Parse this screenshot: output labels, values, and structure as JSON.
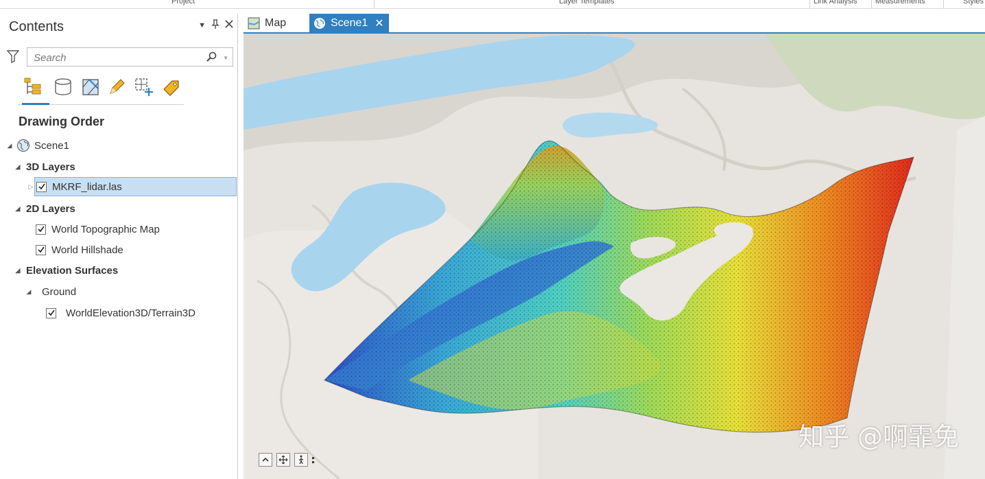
{
  "ribbon": {
    "groups": [
      "Project",
      "Layer Templates",
      "Link Analysis",
      "Measurements",
      "Styles"
    ]
  },
  "contents_pane": {
    "title": "Contents",
    "controls": [
      "chevron-down-icon",
      "pin-icon",
      "close-icon"
    ],
    "search": {
      "placeholder": "Search",
      "value": ""
    },
    "toolbar_icons": [
      "list-by-drawing-order-icon",
      "list-by-data-source-icon",
      "list-by-selection-icon",
      "list-by-editing-icon",
      "list-by-snapping-icon",
      "list-by-labeling-icon"
    ],
    "heading": "Drawing Order",
    "tree": {
      "scene": "Scene1",
      "group_3d": "3D Layers",
      "layer_lidar": "MKRF_lidar.las",
      "group_2d": "2D Layers",
      "layer_topo": "World Topographic Map",
      "layer_hillshade": "World Hillshade",
      "group_elev": "Elevation Surfaces",
      "ground": "Ground",
      "layer_terrain": "WorldElevation3D/Terrain3D"
    }
  },
  "tabs": [
    {
      "label": "Map",
      "icon": "map-icon",
      "active": false
    },
    {
      "label": "Scene1",
      "icon": "globe-icon",
      "active": true
    }
  ],
  "scene_view": {
    "nav_controls": [
      "expand-up-icon",
      "pan-icon",
      "walk-icon"
    ],
    "watermark": "知乎 @啊霏免"
  },
  "colors": {
    "accent": "#2f7fc1",
    "selected_row": "#c9dff1",
    "water": "#a9d4ee",
    "terrain": "#e9e6e1"
  }
}
